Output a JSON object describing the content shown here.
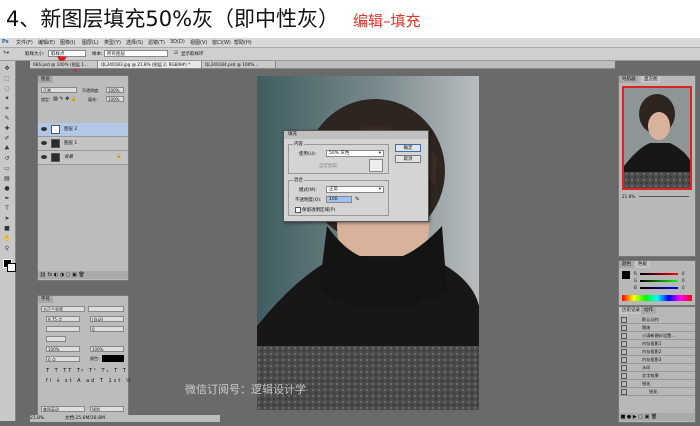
{
  "tutorial": {
    "step_title": "4、新图层填充50%灰（即中性灰）",
    "step_hint": "编辑–填充"
  },
  "colors": {
    "title": "#111111",
    "hint": "#e0352b",
    "annotation_arrow": "#d22222",
    "selected_layer": "#b3c7e6"
  },
  "app": {
    "logo": "Ps",
    "menu": [
      "文件(F)",
      "编辑(E)",
      "图像(I)",
      "图层(L)",
      "类型(Y)",
      "选择(S)",
      "滤镜(T)",
      "3D(D)",
      "视图(V)",
      "窗口(W)",
      "帮助(H)"
    ]
  },
  "options_bar": {
    "sample_label": "取样大小:",
    "sample_value": "取样点",
    "sample_scope_label": "样本:",
    "sample_scope_value": "所有图层",
    "show_ring_label": "显示取样环"
  },
  "doc_tabs": [
    {
      "label": "666.psd @ 100% (图层 1...",
      "active": false
    },
    {
      "label": "QL240183.jpg @ 21.8% (图层 2, RGB/8#) *",
      "active": true
    },
    {
      "label": "QL240184.psd @ 100%...",
      "active": false
    }
  ],
  "layers_panel": {
    "tab_label": "图层",
    "blend_mode": "正常",
    "opacity_label": "不透明度:",
    "opacity_value": "100%",
    "lock_label": "锁定:",
    "fill_label": "填充:",
    "fill_value": "100%",
    "layers": [
      {
        "name": "图层 2",
        "selected": true
      },
      {
        "name": "图层 1",
        "selected": false
      },
      {
        "name": "背景",
        "selected": false
      }
    ]
  },
  "char_panel": {
    "tab_label": "字符",
    "font": "方正兰亭黑",
    "size": "9.75 点",
    "leading": "(自动)",
    "tracking": "0",
    "scale_v": "100%",
    "scale_h": "100%",
    "baseline": "0 点",
    "color_label": "颜色:",
    "language": "美国英语",
    "aa": "锐利"
  },
  "fill_dialog": {
    "title": "填充",
    "content_group": "内容",
    "use_label": "使用(U):",
    "use_value": "50% 灰色",
    "custom_pattern_label": "自定图案:",
    "blending_group": "混合",
    "mode_label": "模式(M):",
    "mode_value": "正常",
    "opacity_label": "不透明度(O):",
    "opacity_value": "100",
    "opacity_unit": "%",
    "preserve_label": "保留透明区域(P)",
    "ok_label": "确定",
    "cancel_label": "取消"
  },
  "watermark": "微信订阅号：逻辑设计学",
  "nav_panel": {
    "tab_label": "导航器",
    "tab2_label": "直方图",
    "zoom": "21.8%"
  },
  "color_panel": {
    "tab_label": "颜色",
    "tab2_label": "色板",
    "r_label": "R",
    "g_label": "G",
    "b_label": "B",
    "r_value": "0",
    "g_value": "0",
    "b_value": "0"
  },
  "actions_panel": {
    "tab_label": "历史记录",
    "tab2_label": "动作",
    "items": [
      "默认动作",
      "颓废",
      "小清新婚纱设置...",
      "内存投影1",
      "内存投影2",
      "内存投影3",
      "水印",
      "文字效果",
      "锐化",
      "锐化"
    ]
  },
  "status": {
    "zoom": "21.8%",
    "doc_info": "文档:25.6M/28.8M"
  }
}
